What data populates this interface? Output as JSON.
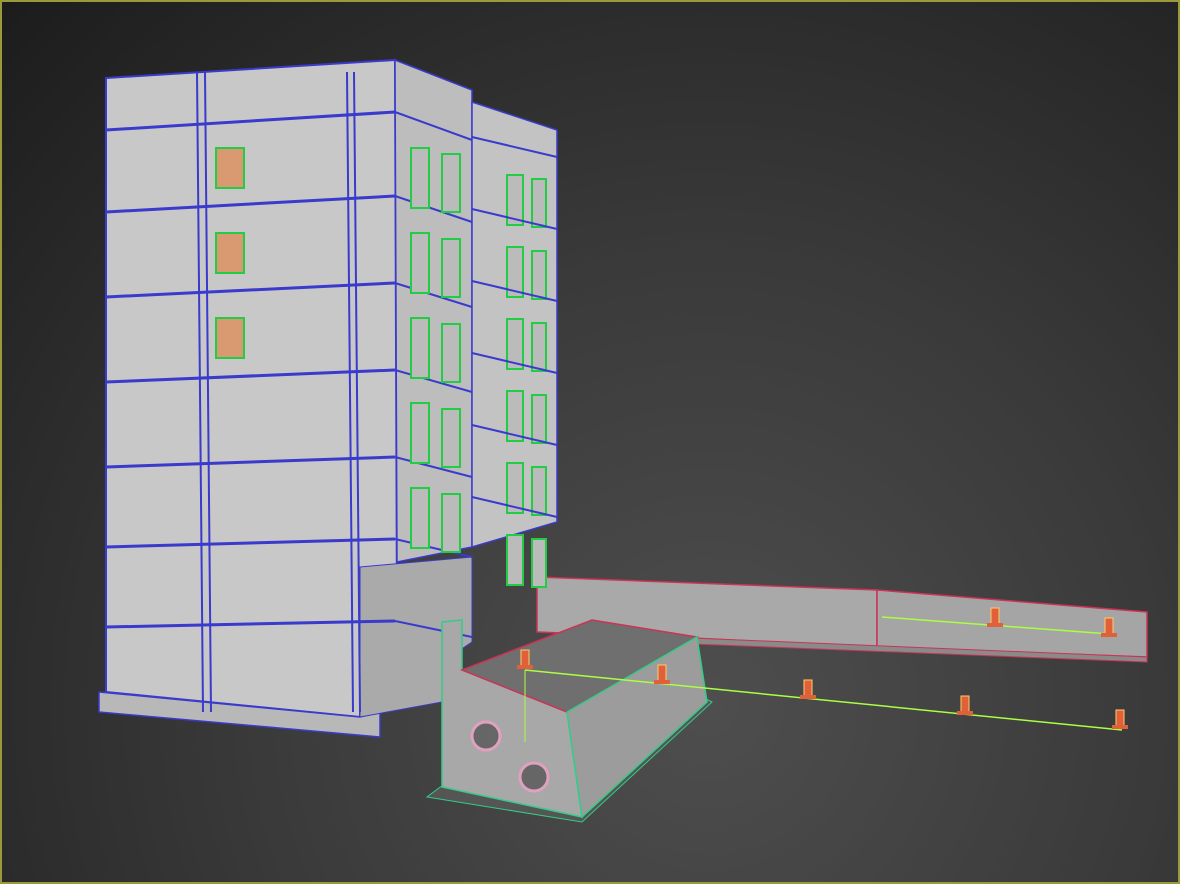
{
  "viewport": {
    "active_border_color": "#9a9a3a",
    "background_top": "#1c1c1c",
    "background_bottom": "#4e4e4e"
  },
  "scene": {
    "floors": 7,
    "colors": {
      "wall_fill": "#c9c9c9",
      "wall_edge": "#3a3acc",
      "window_frame": "#22cc44",
      "window_glass": "#d99a72",
      "accent_edge": "#cc3344",
      "ground_edge": "#33cc88",
      "pipe_line": "#aaff44",
      "peg": "#e0603a"
    }
  }
}
